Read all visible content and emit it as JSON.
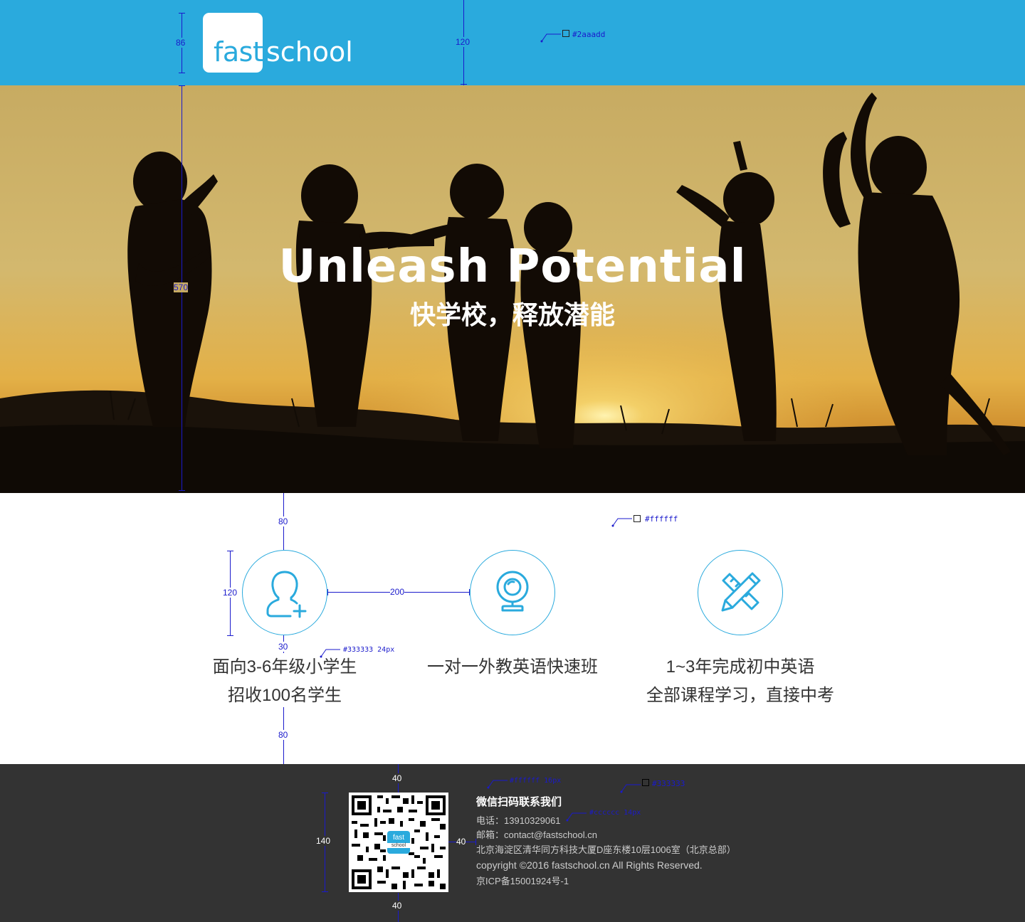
{
  "colors": {
    "brand": "#2aaadd",
    "white": "#ffffff",
    "text": "#333333",
    "footer_bg": "#333333",
    "footer_text": "#cccccc",
    "annotation": "#1a1acc"
  },
  "header": {
    "logo_fast": "fast",
    "logo_school": "school",
    "color_annotation": "#2aaadd",
    "dim_logo": "86",
    "dim_header": "120"
  },
  "hero": {
    "title": "Unleash  Potential",
    "subtitle": "快学校，释放潜能",
    "dim_height": "570"
  },
  "features": {
    "color_annotation": "#ffffff",
    "text_annotation": "#333333 24px",
    "dim_top": "80",
    "dim_circle": "120",
    "dim_gap": "200",
    "dim_text_gap": "30",
    "dim_bottom": "80",
    "items": [
      {
        "icon": "add-user-icon",
        "line1": "面向3-6年级小学生",
        "line2": "招收100名学生"
      },
      {
        "icon": "webcam-icon",
        "line1": "一对一外教英语快速班",
        "line2": ""
      },
      {
        "icon": "pencil-ruler-icon",
        "line1": "1~3年完成初中英语",
        "line2": "全部课程学习，直接中考"
      }
    ]
  },
  "footer": {
    "title": "微信扫码联系我们",
    "phone": "电话：13910329061",
    "email": "邮箱：contact@fastschool.cn",
    "address": "北京海淀区清华同方科技大厦D座东楼10层1006室（北京总部）",
    "copyright": "copyright ©2016 fastschool.cn All Rights Reserved.",
    "icp": "京ICP备15001924号-1",
    "qr_logo": "fast",
    "qr_logo_sub": "school",
    "bg_annotation": "#333333",
    "title_annotation": "#ffffff 16px",
    "text_annotation": "#cccccc 14px",
    "dim_top": "40",
    "dim_qr": "140",
    "dim_gap": "40",
    "dim_bottom": "40"
  }
}
